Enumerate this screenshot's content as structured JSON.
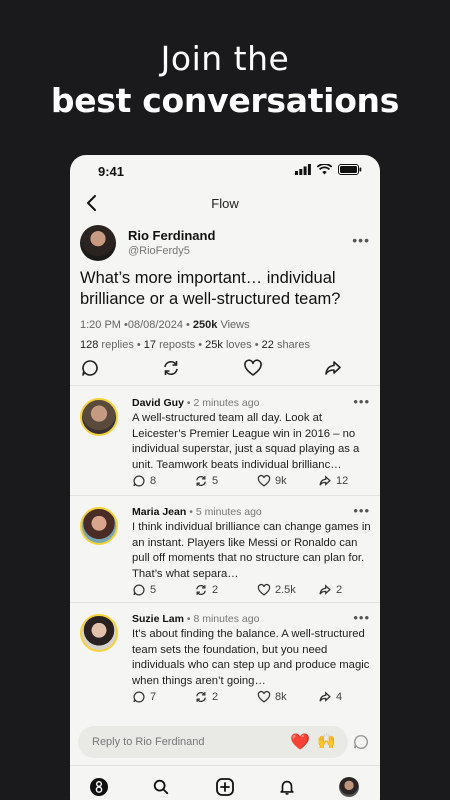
{
  "headline": {
    "line1": "Join the",
    "line2": "best conversations"
  },
  "status": {
    "time": "9:41"
  },
  "nav": {
    "title": "Flow"
  },
  "post": {
    "author_name": "Rio Ferdinand",
    "author_handle": "@RioFerdy5",
    "text": "What’s more important… individual brilliance or a well-structured team?",
    "time": "1:20 PM",
    "date": "08/08/2024",
    "views": "250k",
    "views_label": "Views",
    "replies": "128",
    "replies_label": "replies",
    "reposts": "17",
    "reposts_label": "reposts",
    "loves": "25k",
    "loves_label": "loves",
    "shares": "22",
    "shares_label": "shares"
  },
  "replies": [
    {
      "name": "David Guy",
      "time": "2 minutes ago",
      "text": "A well-structured team all day. Look at Leicester’s Premier League win in 2016 – no individual superstar, just a squad playing as a unit. Teamwork beats individual brillianc…",
      "comments": "8",
      "reposts": "5",
      "loves": "9k",
      "shares": "12",
      "avatar_color": "#5a4a3c"
    },
    {
      "name": "Maria Jean",
      "time": "5 minutes ago",
      "text": "I think individual brilliance can change games in an instant. Players like Messi or Ronaldo can pull off moments that no structure can plan for. That’s what separa…",
      "comments": "5",
      "reposts": "2",
      "loves": "2.5k",
      "shares": "2",
      "avatar_color": "#8a5a48"
    },
    {
      "name": "Suzie Lam",
      "time": "8 minutes ago",
      "text": "It’s about finding the balance. A well-structured team sets the foundation, but you need individuals who can step up and produce magic when things aren’t going…",
      "comments": "7",
      "reposts": "2",
      "loves": "8k",
      "shares": "4",
      "avatar_color": "#c9a48c"
    }
  ],
  "reply_input": {
    "placeholder": "Reply to Rio Ferdinand",
    "emoji1": "❤️",
    "emoji2": "🙌"
  },
  "colors": {
    "background": "#1a1a1c",
    "card": "#f5f5f3",
    "avatar_ring": "#f3d33b"
  }
}
